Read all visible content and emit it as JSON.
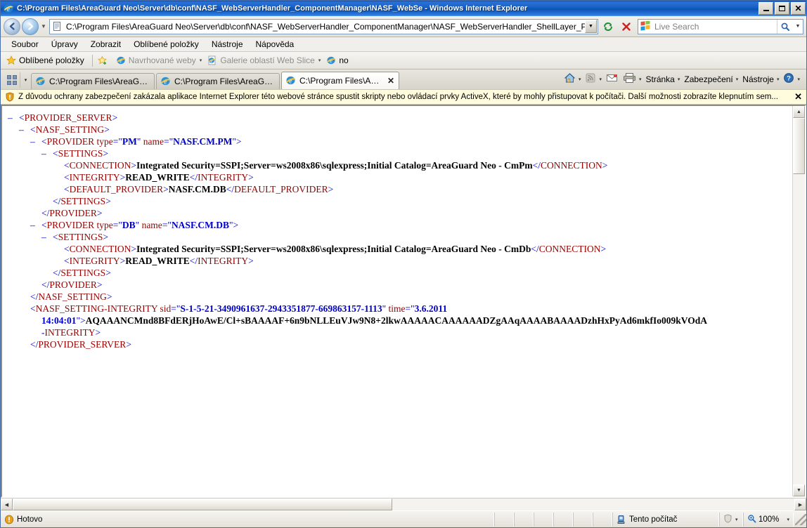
{
  "window": {
    "title": "C:\\Program Files\\AreaGuard Neo\\Server\\db\\conf\\NASF_WebServerHandler_ComponentManager\\NASF_WebSe - Windows Internet Explorer",
    "app_icon": "internet-explorer-icon",
    "minimize_label": "–",
    "maximize_label": "□",
    "close_label": "✕"
  },
  "navbar": {
    "back_glyph": "←",
    "forward_glyph": "→",
    "history_caret": "▼",
    "address_value": "C:\\Program Files\\AreaGuard Neo\\Server\\db\\conf\\NASF_WebServerHandler_ComponentManager\\NASF_WebServerHandler_ShellLayer_P",
    "address_dropdown_caret": "▼",
    "refresh_icon": "refresh-icon",
    "stop_icon": "stop-icon",
    "search_placeholder": "Live Search",
    "search_value": "",
    "search_go_icon": "search-icon",
    "search_dropdown_caret": "▼"
  },
  "menubar": {
    "items": [
      {
        "label": "Soubor",
        "accel": "S"
      },
      {
        "label": "Úpravy",
        "accel": "r"
      },
      {
        "label": "Zobrazit",
        "accel": "a"
      },
      {
        "label": "Oblíbené položky",
        "accel": "y"
      },
      {
        "label": "Nástroje",
        "accel": "e"
      },
      {
        "label": "Nápověda",
        "accel": "N"
      }
    ]
  },
  "favbar": {
    "favorites_label": "Oblíbené položky",
    "items": [
      {
        "label": "Navrhované weby",
        "icon": "ie-icon",
        "caret": "▾",
        "dim": true
      },
      {
        "label": "Galerie oblastí Web Slice",
        "icon": "page-icon",
        "caret": "▾",
        "dim": true
      },
      {
        "label": "no",
        "icon": "ie-icon",
        "caret": "",
        "dim": false
      }
    ]
  },
  "tabbar": {
    "quicktabs_icon": "quick-tabs-icon",
    "tablist_caret": "▾",
    "tabs": [
      {
        "label": "C:\\Program Files\\AreaGuard ...",
        "active": false,
        "closable": false
      },
      {
        "label": "C:\\Program Files\\AreaGuard ...",
        "active": false,
        "closable": false
      },
      {
        "label": "C:\\Program Files\\AreaGu...",
        "active": true,
        "closable": true,
        "close_glyph": "✕"
      }
    ],
    "commands": [
      {
        "label": "",
        "icon": "home-icon",
        "caret": "▾"
      },
      {
        "label": "",
        "icon": "feeds-icon",
        "caret": "▾"
      },
      {
        "label": "",
        "icon": "mail-icon",
        "caret": ""
      },
      {
        "label": "",
        "icon": "print-icon",
        "caret": "▾"
      },
      {
        "label": "Stránka",
        "icon": "",
        "caret": "▾"
      },
      {
        "label": "Zabezpečení",
        "icon": "",
        "caret": "▾"
      },
      {
        "label": "Nástroje",
        "icon": "",
        "caret": "▾"
      },
      {
        "label": "",
        "icon": "help-icon",
        "caret": "▾"
      }
    ]
  },
  "infobar": {
    "icon": "security-shield-icon",
    "message": "Z důvodu ochrany zabezpečení zakázala aplikace Internet Explorer této webové stránce spustit skripty nebo ovládací prvky ActiveX, které by mohly přistupovat k počítači. Další možnosti zobrazíte klepnutím sem...",
    "close_glyph": "✕"
  },
  "content": {
    "type": "xml-tree-view",
    "lines": [
      {
        "indent": 0,
        "collapser": "–",
        "segments": [
          {
            "c": "br",
            "t": "<"
          },
          {
            "c": "tg",
            "t": "PROVIDER_SERVER"
          },
          {
            "c": "br",
            "t": ">"
          }
        ]
      },
      {
        "indent": 1,
        "collapser": "–",
        "segments": [
          {
            "c": "br",
            "t": "<"
          },
          {
            "c": "tg",
            "t": "NASF_SETTING"
          },
          {
            "c": "br",
            "t": ">"
          }
        ]
      },
      {
        "indent": 2,
        "collapser": "–",
        "segments": [
          {
            "c": "br",
            "t": "<"
          },
          {
            "c": "tg",
            "t": "PROVIDER "
          },
          {
            "c": "an",
            "t": "type"
          },
          {
            "c": "br",
            "t": "="
          },
          {
            "c": "br",
            "t": "\""
          },
          {
            "c": "av",
            "t": "PM"
          },
          {
            "c": "br",
            "t": "\""
          },
          {
            "c": "tg",
            "t": " name"
          },
          {
            "c": "br",
            "t": "=\""
          },
          {
            "c": "av",
            "t": "NASF.CM.PM"
          },
          {
            "c": "br",
            "t": "\">"
          }
        ]
      },
      {
        "indent": 3,
        "collapser": "–",
        "segments": [
          {
            "c": "br",
            "t": "<"
          },
          {
            "c": "tg",
            "t": "SETTINGS"
          },
          {
            "c": "br",
            "t": ">"
          }
        ]
      },
      {
        "indent": 4,
        "collapser": "",
        "segments": [
          {
            "c": "br",
            "t": "<"
          },
          {
            "c": "tg",
            "t": "CONNECTION"
          },
          {
            "c": "br",
            "t": ">"
          },
          {
            "c": "txt",
            "t": "Integrated Security=SSPI;Server=ws2008x86\\sqlexpress;Initial Catalog=AreaGuard Neo - CmPm"
          },
          {
            "c": "br",
            "t": "</"
          },
          {
            "c": "tg",
            "t": "CONNECTION"
          },
          {
            "c": "br",
            "t": ">"
          }
        ]
      },
      {
        "indent": 4,
        "collapser": "",
        "segments": [
          {
            "c": "br",
            "t": "<"
          },
          {
            "c": "tg",
            "t": "INTEGRITY"
          },
          {
            "c": "br",
            "t": ">"
          },
          {
            "c": "txt",
            "t": "READ_WRITE"
          },
          {
            "c": "br",
            "t": "</"
          },
          {
            "c": "tg",
            "t": "INTEGRITY"
          },
          {
            "c": "br",
            "t": ">"
          }
        ]
      },
      {
        "indent": 4,
        "collapser": "",
        "segments": [
          {
            "c": "br",
            "t": "<"
          },
          {
            "c": "tg",
            "t": "DEFAULT_PROVIDER"
          },
          {
            "c": "br",
            "t": ">"
          },
          {
            "c": "txt",
            "t": "NASF.CM.DB"
          },
          {
            "c": "br",
            "t": "</"
          },
          {
            "c": "tg",
            "t": "DEFAULT_PROVIDER"
          },
          {
            "c": "br",
            "t": ">"
          }
        ]
      },
      {
        "indent": 3,
        "collapser": "",
        "segments": [
          {
            "c": "br",
            "t": "</"
          },
          {
            "c": "tg",
            "t": "SETTINGS"
          },
          {
            "c": "br",
            "t": ">"
          }
        ]
      },
      {
        "indent": 2,
        "collapser": "",
        "segments": [
          {
            "c": "br",
            "t": "</"
          },
          {
            "c": "tg",
            "t": "PROVIDER"
          },
          {
            "c": "br",
            "t": ">"
          }
        ]
      },
      {
        "indent": 2,
        "collapser": "–",
        "segments": [
          {
            "c": "br",
            "t": "<"
          },
          {
            "c": "tg",
            "t": "PROVIDER "
          },
          {
            "c": "an",
            "t": "type"
          },
          {
            "c": "br",
            "t": "="
          },
          {
            "c": "br",
            "t": "\""
          },
          {
            "c": "av",
            "t": "DB"
          },
          {
            "c": "br",
            "t": "\""
          },
          {
            "c": "tg",
            "t": " name"
          },
          {
            "c": "br",
            "t": "=\""
          },
          {
            "c": "av",
            "t": "NASF.CM.DB"
          },
          {
            "c": "br",
            "t": "\">"
          }
        ]
      },
      {
        "indent": 3,
        "collapser": "–",
        "segments": [
          {
            "c": "br",
            "t": "<"
          },
          {
            "c": "tg",
            "t": "SETTINGS"
          },
          {
            "c": "br",
            "t": ">"
          }
        ]
      },
      {
        "indent": 4,
        "collapser": "",
        "segments": [
          {
            "c": "br",
            "t": "<"
          },
          {
            "c": "tg",
            "t": "CONNECTION"
          },
          {
            "c": "br",
            "t": ">"
          },
          {
            "c": "txt",
            "t": "Integrated Security=SSPI;Server=ws2008x86\\sqlexpress;Initial Catalog=AreaGuard Neo - CmDb"
          },
          {
            "c": "br",
            "t": "</"
          },
          {
            "c": "tg",
            "t": "CONNECTION"
          },
          {
            "c": "br",
            "t": ">"
          }
        ]
      },
      {
        "indent": 4,
        "collapser": "",
        "segments": [
          {
            "c": "br",
            "t": "<"
          },
          {
            "c": "tg",
            "t": "INTEGRITY"
          },
          {
            "c": "br",
            "t": ">"
          },
          {
            "c": "txt",
            "t": "READ_WRITE"
          },
          {
            "c": "br",
            "t": "</"
          },
          {
            "c": "tg",
            "t": "INTEGRITY"
          },
          {
            "c": "br",
            "t": ">"
          }
        ]
      },
      {
        "indent": 3,
        "collapser": "",
        "segments": [
          {
            "c": "br",
            "t": "</"
          },
          {
            "c": "tg",
            "t": "SETTINGS"
          },
          {
            "c": "br",
            "t": ">"
          }
        ]
      },
      {
        "indent": 2,
        "collapser": "",
        "segments": [
          {
            "c": "br",
            "t": "</"
          },
          {
            "c": "tg",
            "t": "PROVIDER"
          },
          {
            "c": "br",
            "t": ">"
          }
        ]
      },
      {
        "indent": 1,
        "collapser": "",
        "segments": [
          {
            "c": "br",
            "t": "</"
          },
          {
            "c": "tg",
            "t": "NASF_SETTING"
          },
          {
            "c": "br",
            "t": ">"
          }
        ]
      },
      {
        "indent": 1,
        "collapser": "",
        "segments": [
          {
            "c": "br",
            "t": "<"
          },
          {
            "c": "tg",
            "t": "NASF_SETTING-INTEGRITY "
          },
          {
            "c": "an",
            "t": "sid"
          },
          {
            "c": "br",
            "t": "=\""
          },
          {
            "c": "av",
            "t": "S-1-5-21-3490961637-2943351877-669863157-1113"
          },
          {
            "c": "br",
            "t": "\""
          },
          {
            "c": "an",
            "t": " time"
          },
          {
            "c": "br",
            "t": "=\""
          },
          {
            "c": "av",
            "t": "3.6.2011"
          }
        ]
      },
      {
        "indent": 2,
        "collapser": "",
        "segments": [
          {
            "c": "av",
            "t": "14:04:01"
          },
          {
            "c": "br",
            "t": "\">"
          },
          {
            "c": "txt",
            "t": "AQAAANCMnd8BFdERjHoAwE/Cl+sBAAAAF+6n9bNLLEuVJw9N8+2lkwAAAAACAAAAAADZgAAqAAAABAAAADzhHxPyAd6mkfIo009kVOdA"
          }
        ]
      },
      {
        "indent": 2,
        "collapser": "",
        "segments": [
          {
            "c": "br",
            "t": "-"
          },
          {
            "c": "tg",
            "t": "INTEGRITY"
          },
          {
            "c": "br",
            "t": ">"
          }
        ]
      },
      {
        "indent": 1,
        "collapser": "",
        "segments": [
          {
            "c": "br",
            "t": "</"
          },
          {
            "c": "tg",
            "t": "PROVIDER_SERVER"
          },
          {
            "c": "br",
            "t": ">"
          }
        ]
      }
    ]
  },
  "scrollbars": {
    "vertical_up": "▲",
    "vertical_down": "▼",
    "horizontal_left": "◀",
    "horizontal_right": "▶"
  },
  "statusbar": {
    "status_text": "Hotovo",
    "status_icon": "warning-icon",
    "zone_text": "Tento počítač",
    "zone_icon": "computer-icon",
    "protected_icon": "protected-mode-icon",
    "protected_caret": "▾",
    "zoom_icon": "zoom-icon",
    "zoom_level": "100%",
    "zoom_caret": "▾"
  }
}
